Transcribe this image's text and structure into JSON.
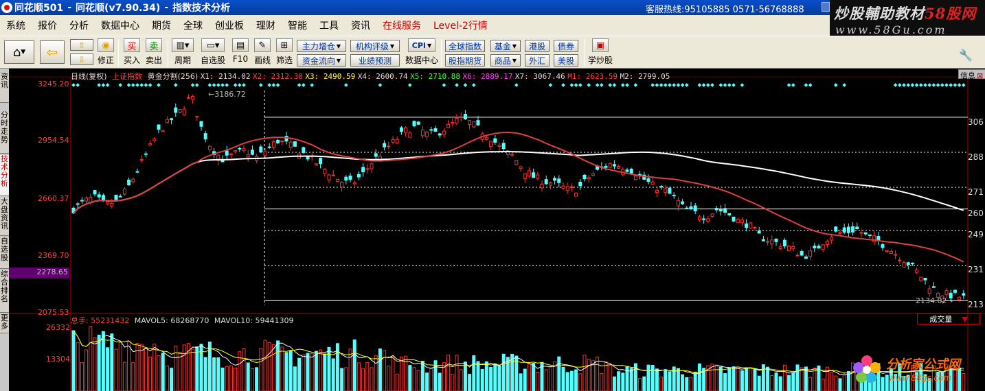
{
  "window": {
    "app_name": "同花顺501",
    "version": "同花顺(v7.90.34)",
    "view": "指数技术分析",
    "hotline": "客服热线:95105885  0571-56768888"
  },
  "watermark_top": {
    "line1_a": "炒股輔助教材",
    "line1_b": "58股网",
    "line2": "www.58Gu.com"
  },
  "watermark_bottom": {
    "name": "分析家公式网",
    "url": "www.88gs.com"
  },
  "menu": [
    "系统",
    "报价",
    "分析",
    "数据中心",
    "期货",
    "全球",
    "创业板",
    "理财",
    "智能",
    "工具",
    "资讯"
  ],
  "menu_special": [
    "在线服务",
    "Level-2行情"
  ],
  "toolbar": {
    "fix": "修正",
    "buy": "买入",
    "sell": "卖出",
    "buy_icon": "买",
    "sell_icon": "卖",
    "period": "周期",
    "watchlist": "自选股",
    "f10": "F10",
    "draw": "画线",
    "filter": "筛选",
    "datacenter": "数据中心",
    "learn": "学炒股",
    "cpi": "CPI",
    "btn_main_force": "主力增仓",
    "btn_fund_flow": "资金流向",
    "btn_inst_rating": "机构评级",
    "btn_forecast": "业绩预测",
    "btn_global_index": "全球指数",
    "btn_index_futures": "股指期货",
    "btn_fund": "基金",
    "btn_commodity": "商品",
    "btn_hk": "港股",
    "btn_forex": "外汇",
    "btn_bond": "债券",
    "btn_us": "美股"
  },
  "left_tabs": [
    "资讯",
    "分时走势",
    "技术分析",
    "大盘资讯",
    "自选股",
    "综合排名",
    "更多"
  ],
  "chart_info": {
    "period": "日线(复权)",
    "index": "上证指数",
    "golden": "黄金分割(256)",
    "x1": "X1: 2134.02",
    "x2": "X2: 2312.30",
    "x3": "X3: 2490.59",
    "x4": "X4: 2600.74",
    "x5": "X5: 2710.88",
    "x6": "X6: 2889.17",
    "x7": "X7: 3067.46",
    "m1": "M1: 2623.59",
    "m2": "M2: 2799.05",
    "info_button": "信息"
  },
  "price_axis": [
    "3245.20",
    "2954.54",
    "2660.37",
    "2369.70",
    "2075.53"
  ],
  "current_price": "2278.65",
  "right_axis": [
    "306",
    "288",
    "271",
    "260",
    "249",
    "231",
    "213"
  ],
  "annotations": {
    "high": "3186.72",
    "low": "2134.02"
  },
  "volume": {
    "label": "总手: 55231432",
    "mavol5": "MAVOL5: 68268770",
    "mavol10": "MAVOL10: 59441309",
    "select": "成交量",
    "max": "26332",
    "mid": "13304"
  },
  "colors": {
    "up": "#ff3232",
    "down": "#54ffff",
    "ma_long": "#ffffff",
    "ma_mid": "#e04040",
    "level": "#ffffff"
  },
  "chart_data": {
    "type": "candlestick",
    "ylim": [
      2075.53,
      3245.2
    ],
    "golden_levels": [
      3067.46,
      2889.17,
      2710.88,
      2600.74,
      2490.59,
      2312.3,
      2134.02
    ],
    "close_path": [
      2600,
      2640,
      2660,
      2620,
      2640,
      2700,
      2800,
      2900,
      3000,
      3050,
      3100,
      3180,
      3000,
      2900,
      2850,
      2880,
      2900,
      2860,
      2900,
      2950,
      2930,
      2900,
      2860,
      2820,
      2780,
      2740,
      2730,
      2780,
      2850,
      2900,
      2950,
      3000,
      3020,
      2980,
      2990,
      3020,
      3060,
      3040,
      3000,
      2960,
      2900,
      2870,
      2800,
      2760,
      2740,
      2730,
      2700,
      2700,
      2760,
      2800,
      2830,
      2820,
      2800,
      2760,
      2720,
      2700,
      2660,
      2600,
      2580,
      2560,
      2600,
      2580,
      2540,
      2520,
      2460,
      2440,
      2420,
      2400,
      2360,
      2380,
      2440,
      2480,
      2480,
      2500,
      2460,
      2440,
      2400,
      2360,
      2320,
      2260,
      2200,
      2170,
      2160,
      2150
    ]
  }
}
